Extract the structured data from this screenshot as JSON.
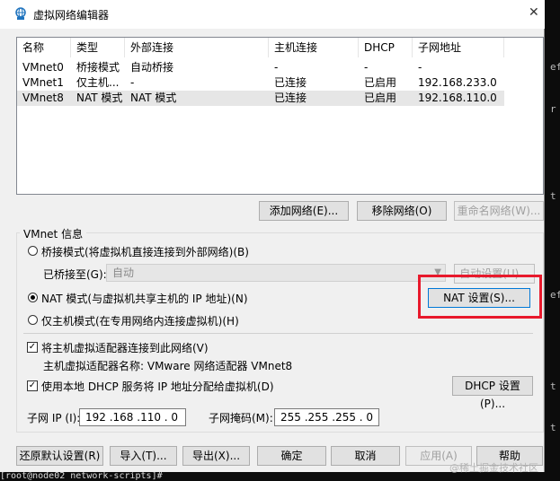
{
  "window": {
    "title": "虚拟网络编辑器",
    "close": "✕"
  },
  "table": {
    "headers": [
      "名称",
      "类型",
      "外部连接",
      "主机连接",
      "DHCP",
      "子网地址"
    ],
    "rows": [
      [
        "VMnet0",
        "桥接模式",
        "自动桥接",
        "-",
        "-",
        "-"
      ],
      [
        "VMnet1",
        "仅主机...",
        "-",
        "已连接",
        "已启用",
        "192.168.233.0"
      ],
      [
        "VMnet8",
        "NAT 模式",
        "NAT 模式",
        "已连接",
        "已启用",
        "192.168.110.0"
      ]
    ],
    "selected_row": 2
  },
  "net_buttons": {
    "add": "添加网络(E)...",
    "remove": "移除网络(O)",
    "rename": "重命名网络(W)..."
  },
  "info": {
    "group_title": "VMnet 信息",
    "bridge_mode": "桥接模式(将虚拟机直接连接到外部网络)(B)",
    "bridged_to_label": "已桥接至(G):",
    "bridged_to_value": "自动",
    "auto_settings": "自动设置(U)...",
    "nat_mode": "NAT 模式(与虚拟机共享主机的 IP 地址)(N)",
    "nat_settings": "NAT 设置(S)...",
    "host_only": "仅主机模式(在专用网络内连接虚拟机)(H)",
    "connect_adapter": "将主机虚拟适配器连接到此网络(V)",
    "adapter_name": "主机虚拟适配器名称: VMware 网络适配器 VMnet8",
    "use_dhcp": "使用本地 DHCP 服务将 IP 地址分配给虚拟机(D)",
    "dhcp_settings": "DHCP 设置(P)...",
    "subnet_ip_label": "子网 IP (I):",
    "subnet_ip": "192 .168 .110 .  0",
    "subnet_mask_label": "子网掩码(M):",
    "subnet_mask": "255 .255 .255 .  0"
  },
  "footer": {
    "restore": "还原默认设置(R)",
    "import": "导入(T)...",
    "export": "导出(X)...",
    "ok": "确定",
    "cancel": "取消",
    "apply": "应用(A)",
    "help": "帮助"
  },
  "terminal": {
    "bottom_line": "[root@node02 network-scripts]#",
    "side_chars": [
      "ef",
      "r",
      "t",
      "ef",
      "t",
      "t"
    ]
  },
  "watermark": "@稀土掘金技术社区"
}
